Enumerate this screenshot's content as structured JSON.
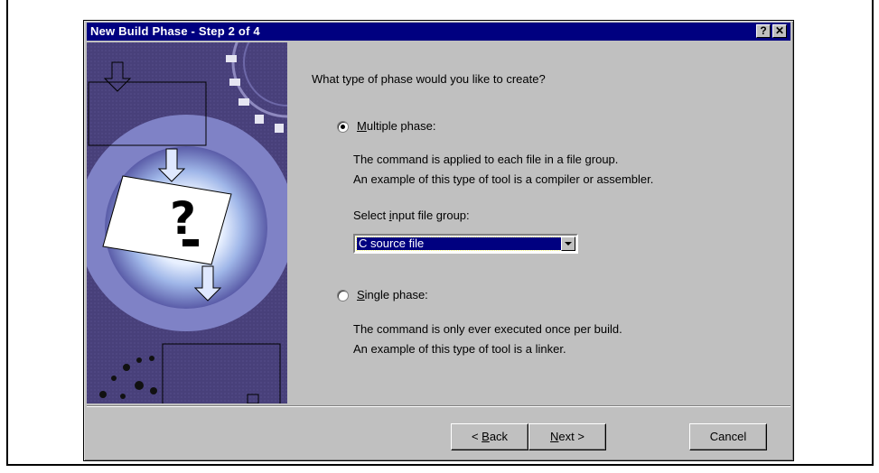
{
  "window": {
    "title": "New Build Phase - Step 2 of 4",
    "help_button": "?",
    "close_button": "✕"
  },
  "main": {
    "prompt": "What type of phase would you like to create?",
    "multiple": {
      "label_mnemonic": "M",
      "label_rest": "ultiple phase:",
      "selected": true,
      "desc_line1": "The command is applied to each file in a file group.",
      "desc_line2": "An example of this type of tool is a compiler or assembler."
    },
    "input_group": {
      "label_pre": "Select ",
      "label_mnemonic": "i",
      "label_post": "nput file group:",
      "value": "C source file"
    },
    "single": {
      "label_mnemonic": "S",
      "label_rest": "ingle phase:",
      "selected": false,
      "desc_line1": "The command is only ever executed once per build.",
      "desc_line2": "An example of this type of tool is a linker."
    }
  },
  "buttons": {
    "back_pre": "< ",
    "back_mnemonic": "B",
    "back_post": "ack",
    "next_mnemonic": "N",
    "next_post": "ext >",
    "cancel": "Cancel"
  },
  "colors": {
    "title_bar": "#000080",
    "dialog_face": "#c0c0c0",
    "art_background": "#48407a"
  }
}
